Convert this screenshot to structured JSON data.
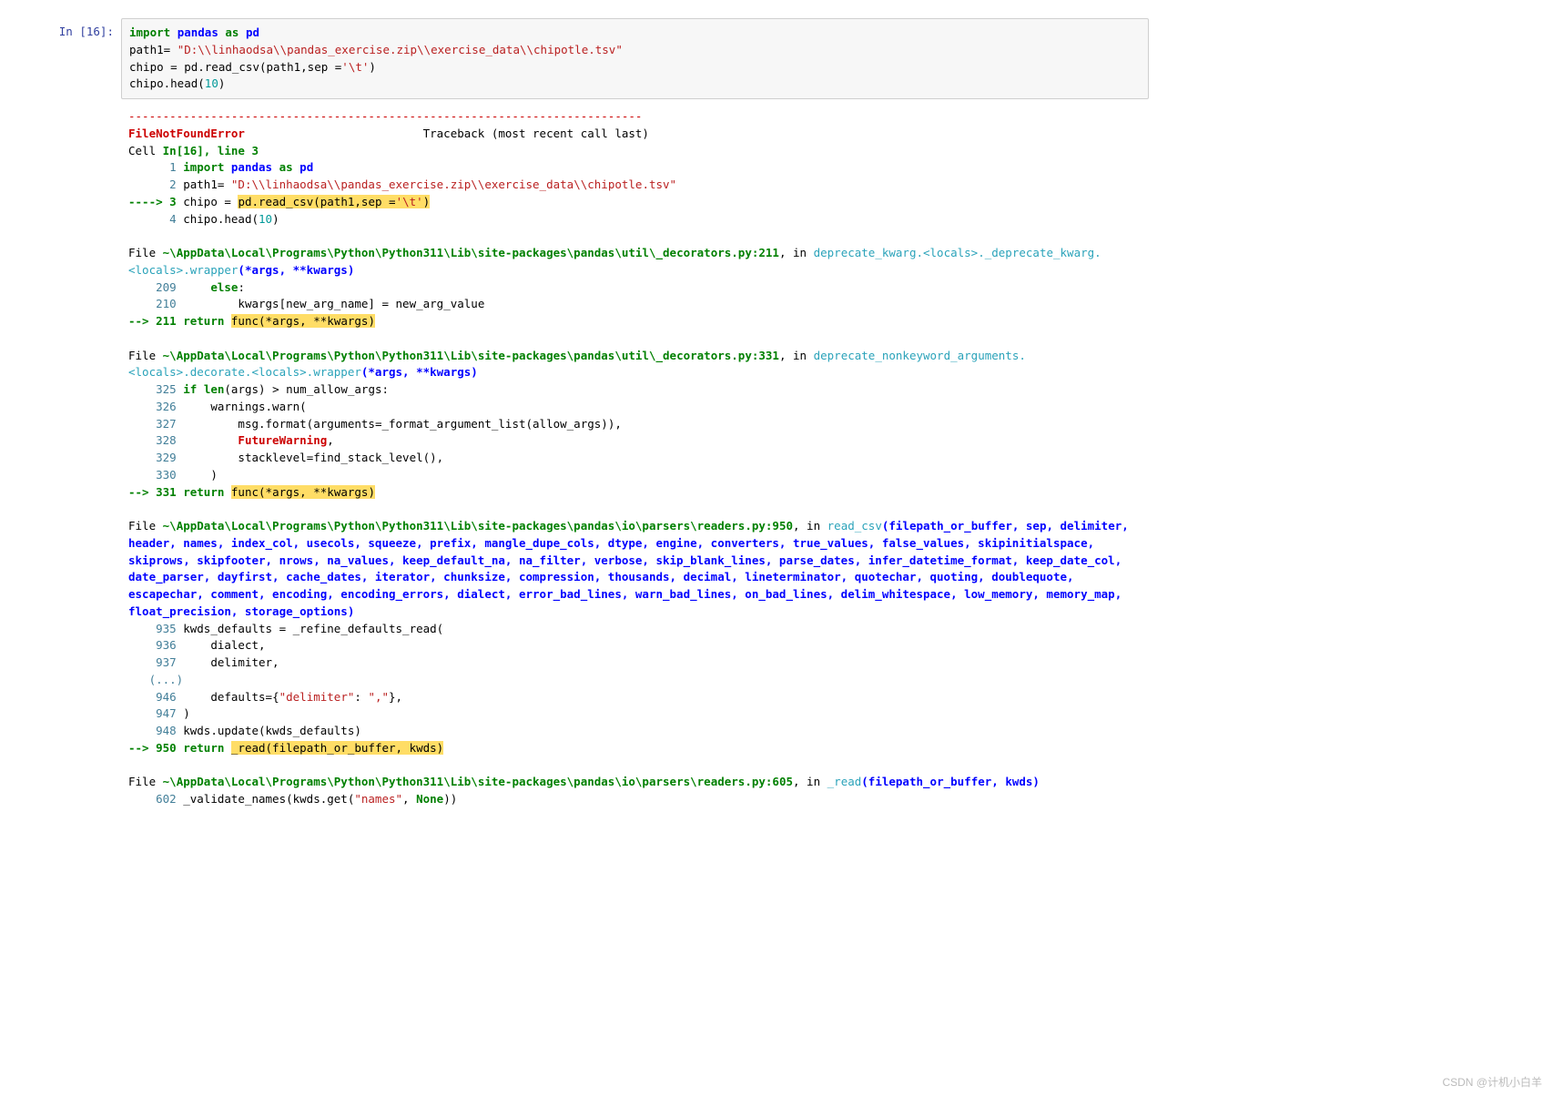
{
  "prompt": "In  [16]:",
  "input": {
    "l1_kw1": "import",
    "l1_kw2": "pandas",
    "l1_kw3": "as",
    "l1_kw4": "pd",
    "l2a": "path1= ",
    "l2b": "\"D:\\\\linhaodsa\\\\pandas_exercise.zip\\\\exercise_data\\\\chipotle.tsv\"",
    "l3a": "chipo = pd.read_csv(path1,sep =",
    "l3b": "'\\t'",
    "l3c": ")",
    "l4a": "chipo.head(",
    "l4b": "10",
    "l4c": ")"
  },
  "out": {
    "dashes": "---------------------------------------------------------------------------",
    "err_name": "FileNotFoundError",
    "err_tb": "                          Traceback (most recent call last)",
    "cell_a": "Cell ",
    "cell_b": "In[16], line 3",
    "ln1": "      1 ",
    "ln1_k1": "import",
    "ln1_k2": " pandas ",
    "ln1_k3": "as",
    "ln1_k4": " pd",
    "ln2": "      2 ",
    "ln2_a": "path1= ",
    "ln2_b": "\"D:\\\\linhaodsa\\\\pandas_exercise.zip\\\\exercise_data\\\\chipotle.tsv\"",
    "ln3_arrow": "----> 3 ",
    "ln3_a": "chipo ",
    "ln3_eq": "=",
    "ln3_sp": " ",
    "ln3_hl_a": "pd",
    "ln3_hl_b": ".",
    "ln3_hl_c": "read_csv(path1,sep ",
    "ln3_hl_d": "=",
    "ln3_hl_e": "'\\t'",
    "ln3_hl_f": ")",
    "ln4": "      4 ",
    "ln4_a": "chipo.head(",
    "ln4_b": "10",
    "ln4_c": ")",
    "f1_a": "File ",
    "f1_b": "~\\AppData\\Local\\Programs\\Python\\Python311\\Lib\\site-packages\\pandas\\util\\_decorators.py:211",
    "f1_c": ", in ",
    "f1_d": "deprecate_kwarg.<locals>._deprecate_kwarg.<locals>.wrapper",
    "f1_e": "(*args, **kwargs)",
    "f1_l1n": "    209",
    "f1_l1a": "     ",
    "f1_l1b": "else",
    "f1_l1c": ":",
    "f1_l2n": "    210",
    "f1_l2a": "         kwargs[new_arg_name] ",
    "f1_l2b": "=",
    "f1_l2c": " new_arg_value",
    "f1_l3_arrow": "--> ",
    "f1_l3n": "211",
    "f1_l3sp": " ",
    "f1_l3a": "return",
    "f1_l3sp2": " ",
    "f1_l3b": "func(",
    "f1_l3c": "*",
    "f1_l3d": "args, ",
    "f1_l3e": "**",
    "f1_l3f": "kwargs)",
    "f2_a": "File ",
    "f2_b": "~\\AppData\\Local\\Programs\\Python\\Python311\\Lib\\site-packages\\pandas\\util\\_decorators.py:331",
    "f2_c": ", in ",
    "f2_d": "deprecate_nonkeyword_arguments.<locals>.decorate.<locals>.wrapper",
    "f2_e": "(*args, **kwargs)",
    "f2_l1n": "    325",
    "f2_l1a": " ",
    "f2_l1b": "if",
    "f2_l1c": " ",
    "f2_l1d": "len",
    "f2_l1e": "(args) ",
    "f2_l1f": ">",
    "f2_l1g": " num_allow_args:",
    "f2_l2n": "    326",
    "f2_l2a": "     warnings.warn(",
    "f2_l3n": "    327",
    "f2_l3a": "         msg.format(arguments",
    "f2_l3b": "=",
    "f2_l3c": "_format_argument_list(allow_args)),",
    "f2_l4n": "    328",
    "f2_l4a": "         ",
    "f2_l4b": "FutureWarning",
    "f2_l4c": ",",
    "f2_l5n": "    329",
    "f2_l5a": "         stacklevel",
    "f2_l5b": "=",
    "f2_l5c": "find_stack_level(),",
    "f2_l6n": "    330",
    "f2_l6a": "     )",
    "f2_l7_arrow": "--> ",
    "f2_l7n": "331",
    "f2_l7sp": " ",
    "f2_l7a": "return",
    "f2_l7sp2": " ",
    "f2_l7b": "func(",
    "f2_l7c": "*",
    "f2_l7d": "args, ",
    "f2_l7e": "**",
    "f2_l7f": "kwargs)",
    "f3_a": "File ",
    "f3_b": "~\\AppData\\Local\\Programs\\Python\\Python311\\Lib\\site-packages\\pandas\\io\\parsers\\readers.py:950",
    "f3_c": ", in ",
    "f3_d": "read_csv",
    "f3_e": "(filepath_or_buffer, sep, delimiter, header, names, index_col, usecols, squeeze, prefix, mangle_dupe_cols, dtype, engine, converters, true_values, false_values, skipinitialspace, skiprows, skipfooter, nrows, na_values, keep_default_na, na_filter, verbose, skip_blank_lines, parse_dates, infer_datetime_format, keep_date_col, date_parser, dayfirst, cache_dates, iterator, chunksize, compression, thousands, decimal, lineterminator, quotechar, quoting, doublequote, escapechar, comment, encoding, encoding_errors, dialect, error_bad_lines, warn_bad_lines, on_bad_lines, delim_whitespace, low_memory, memory_map, float_precision, storage_options)",
    "f3_l1n": "    935",
    "f3_l1a": " kwds_defaults ",
    "f3_l1b": "=",
    "f3_l1c": " _refine_defaults_read(",
    "f3_l2n": "    936",
    "f3_l2a": "     dialect,",
    "f3_l3n": "    937",
    "f3_l3a": "     delimiter,",
    "f3_ell": "   (...)",
    "f3_l4n": "    946",
    "f3_l4a": "     defaults",
    "f3_l4b": "=",
    "f3_l4c": "{",
    "f3_l4d": "\"delimiter\"",
    "f3_l4e": ": ",
    "f3_l4f": "\",\"",
    "f3_l4g": "},",
    "f3_l5n": "    947",
    "f3_l5a": " )",
    "f3_l6n": "    948",
    "f3_l6a": " kwds.update(kwds_defaults)",
    "f3_l7_arrow": "--> ",
    "f3_l7n": "950",
    "f3_l7sp": " ",
    "f3_l7a": "return",
    "f3_l7sp2": " ",
    "f3_l7b": "_read(filepath_or_buffer, kwds)",
    "f4_a": "File ",
    "f4_b": "~\\AppData\\Local\\Programs\\Python\\Python311\\Lib\\site-packages\\pandas\\io\\parsers\\readers.py:605",
    "f4_c": ", in ",
    "f4_d": "_read",
    "f4_e": "(filepath_or_buffer, kwds)",
    "f4_l1n": "    602",
    "f4_l1a": " _validate_names(kwds.get(",
    "f4_l1b": "\"names\"",
    "f4_l1c": ", ",
    "f4_l1d": "None",
    "f4_l1e": "))"
  },
  "watermark": "CSDN @计机小白羊"
}
